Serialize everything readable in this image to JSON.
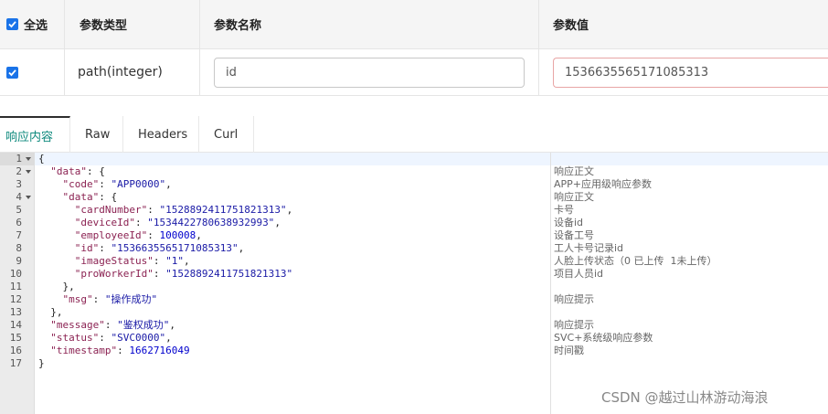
{
  "params": {
    "headers": {
      "select_all": "全选",
      "type": "参数类型",
      "name": "参数名称",
      "value": "参数值"
    },
    "row": {
      "checked": true,
      "type": "path(integer)",
      "name": "id",
      "value": "1536635565171085313"
    }
  },
  "tabs": [
    {
      "label": "响应内容",
      "active": true
    },
    {
      "label": "Raw",
      "active": false
    },
    {
      "label": "Headers",
      "active": false
    },
    {
      "label": "Curl",
      "active": false
    }
  ],
  "code_lines": [
    {
      "n": "1",
      "fold": true,
      "text": "{"
    },
    {
      "n": "2",
      "fold": true,
      "text": "  \"data\": {"
    },
    {
      "n": "3",
      "fold": false,
      "text": "    \"code\": \"APP0000\","
    },
    {
      "n": "4",
      "fold": true,
      "text": "    \"data\": {"
    },
    {
      "n": "5",
      "fold": false,
      "text": "      \"cardNumber\": \"1528892411751821313\","
    },
    {
      "n": "6",
      "fold": false,
      "text": "      \"deviceId\": \"1534422780638932993\","
    },
    {
      "n": "7",
      "fold": false,
      "text": "      \"employeeId\": 100008,"
    },
    {
      "n": "8",
      "fold": false,
      "text": "      \"id\": \"1536635565171085313\","
    },
    {
      "n": "9",
      "fold": false,
      "text": "      \"imageStatus\": \"1\","
    },
    {
      "n": "10",
      "fold": false,
      "text": "      \"proWorkerId\": \"1528892411751821313\""
    },
    {
      "n": "11",
      "fold": false,
      "text": "    },"
    },
    {
      "n": "12",
      "fold": false,
      "text": "    \"msg\": \"操作成功\""
    },
    {
      "n": "13",
      "fold": false,
      "text": "  },"
    },
    {
      "n": "14",
      "fold": false,
      "text": "  \"message\": \"鉴权成功\","
    },
    {
      "n": "15",
      "fold": false,
      "text": "  \"status\": \"SVC0000\","
    },
    {
      "n": "16",
      "fold": false,
      "text": "  \"timestamp\": 1662716049"
    },
    {
      "n": "17",
      "fold": false,
      "text": "}"
    }
  ],
  "comments": [
    {
      "line": 2,
      "text": "响应正文"
    },
    {
      "line": 3,
      "text": "APP+应用级响应参数"
    },
    {
      "line": 4,
      "text": "响应正文"
    },
    {
      "line": 5,
      "text": "卡号"
    },
    {
      "line": 6,
      "text": "设备id"
    },
    {
      "line": 7,
      "text": "设备工号"
    },
    {
      "line": 8,
      "text": "工人卡号记录id"
    },
    {
      "line": 9,
      "text": "人脸上传状态（0 已上传  1未上传）"
    },
    {
      "line": 10,
      "text": "项目人员id"
    },
    {
      "line": 12,
      "text": "响应提示"
    },
    {
      "line": 14,
      "text": "响应提示"
    },
    {
      "line": 15,
      "text": "SVC+系统级响应参数"
    },
    {
      "line": 16,
      "text": "时间戳"
    }
  ],
  "watermark": "CSDN @越过山林游动海浪",
  "colors": {
    "accent": "#0f8a7e",
    "checkbox": "#1a73e8",
    "key": "#8b2252",
    "string": "#1a1aa6"
  }
}
